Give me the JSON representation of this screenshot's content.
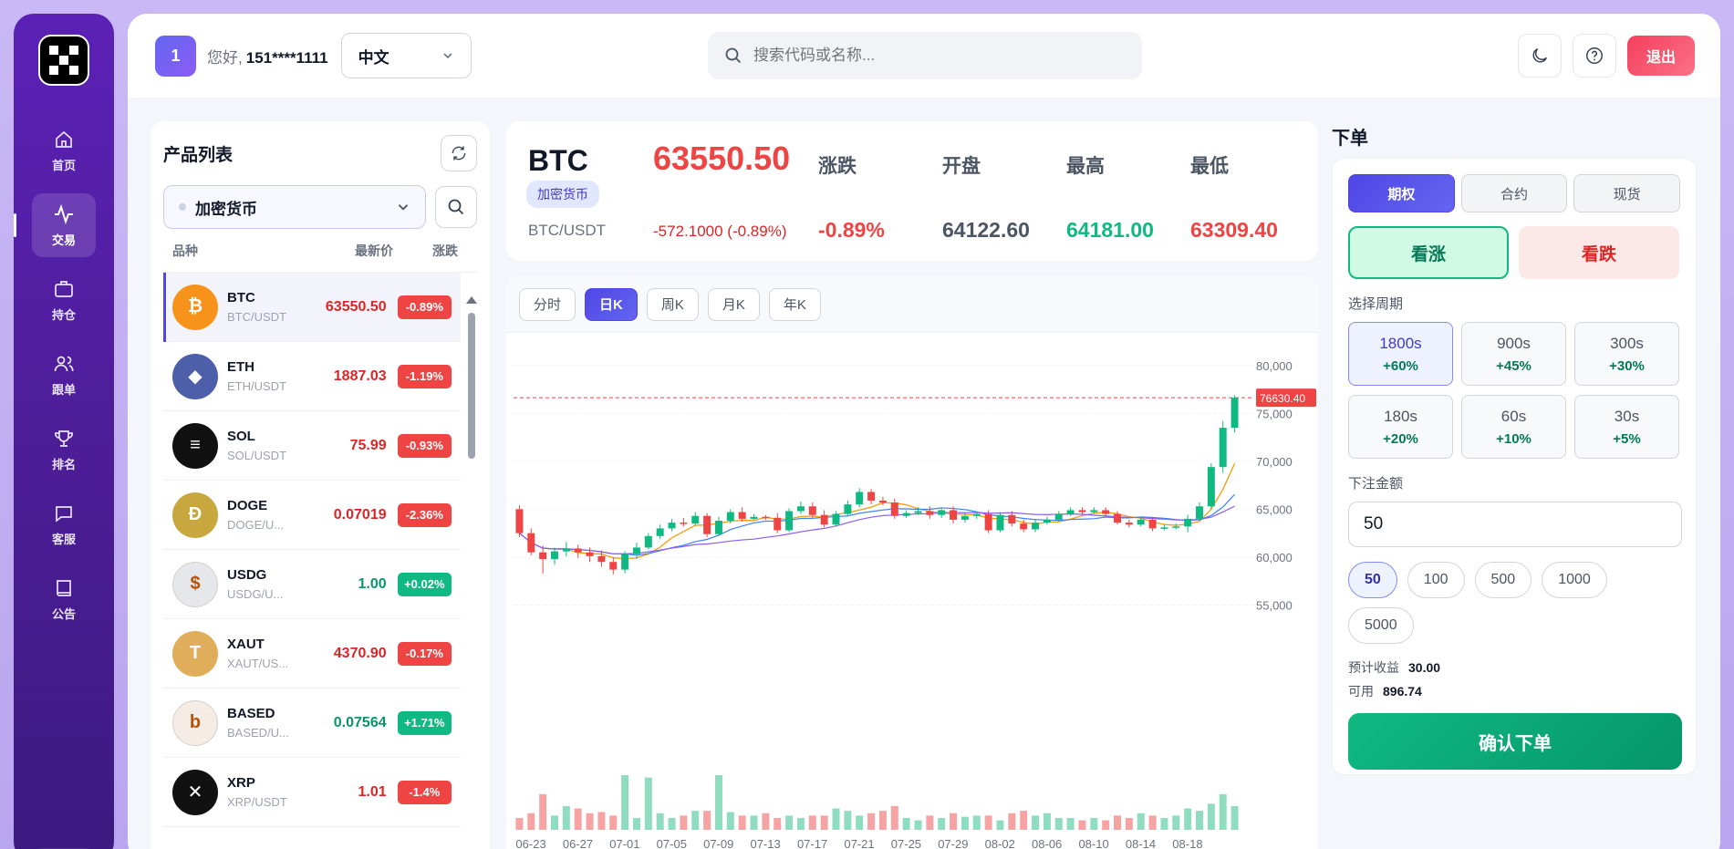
{
  "nav": {
    "items": [
      {
        "label": "首页",
        "icon": "home-icon"
      },
      {
        "label": "交易",
        "icon": "activity-icon",
        "active": true
      },
      {
        "label": "持仓",
        "icon": "briefcase-icon"
      },
      {
        "label": "跟单",
        "icon": "users-icon"
      },
      {
        "label": "排名",
        "icon": "trophy-icon"
      },
      {
        "label": "客服",
        "icon": "chat-icon"
      },
      {
        "label": "公告",
        "icon": "book-icon"
      }
    ]
  },
  "header": {
    "user_badge": "1",
    "greeting": "您好,",
    "username": "151****1111",
    "language": "中文",
    "search_placeholder": "搜索代码或名称...",
    "logout_label": "退出"
  },
  "products": {
    "title": "产品列表",
    "category": "加密货币",
    "columns": {
      "name": "品种",
      "price": "最新价",
      "change": "涨跌"
    },
    "items": [
      {
        "symbol": "BTC",
        "pair": "BTC/USDT",
        "price": "63550.50",
        "change": "-0.89%",
        "dir": "neg",
        "color": "#f7931a",
        "glyph": "₿"
      },
      {
        "symbol": "ETH",
        "pair": "ETH/USDT",
        "price": "1887.03",
        "change": "-1.19%",
        "dir": "neg",
        "color": "#4c5fa8",
        "glyph": "◆"
      },
      {
        "symbol": "SOL",
        "pair": "SOL/USDT",
        "price": "75.99",
        "change": "-0.93%",
        "dir": "neg",
        "color": "#111111",
        "glyph": "≡"
      },
      {
        "symbol": "DOGE",
        "pair": "DOGE/U...",
        "price": "0.07019",
        "change": "-2.36%",
        "dir": "neg",
        "color": "#c9a73f",
        "glyph": "Ð"
      },
      {
        "symbol": "USDG",
        "pair": "USDG/U...",
        "price": "1.00",
        "change": "+0.02%",
        "dir": "pos",
        "color": "#e5e7eb",
        "glyph": "$"
      },
      {
        "symbol": "XAUT",
        "pair": "XAUT/US...",
        "price": "4370.90",
        "change": "-0.17%",
        "dir": "neg",
        "color": "#e0ad5b",
        "glyph": "T"
      },
      {
        "symbol": "BASED",
        "pair": "BASED/U...",
        "price": "0.07564",
        "change": "+1.71%",
        "dir": "pos",
        "color": "#f5ece6",
        "glyph": "b"
      },
      {
        "symbol": "XRP",
        "pair": "XRP/USDT",
        "price": "1.01",
        "change": "-1.4%",
        "dir": "neg",
        "color": "#111111",
        "glyph": "✕"
      }
    ]
  },
  "quote": {
    "symbol": "BTC",
    "tag": "加密货币",
    "pair": "BTC/USDT",
    "price": "63550.50",
    "change_abs": "-572.1000 (-0.89%)",
    "labels": {
      "change": "涨跌",
      "open": "开盘",
      "high": "最高",
      "low": "最低"
    },
    "values": {
      "change": "-0.89%",
      "open": "64122.60",
      "high": "64181.00",
      "low": "63309.40"
    },
    "colors": {
      "down": "#ef4444",
      "up": "#10b981",
      "neutral": "#4b5563"
    }
  },
  "timeframes": [
    {
      "label": "分时"
    },
    {
      "label": "日K",
      "active": true
    },
    {
      "label": "周K"
    },
    {
      "label": "月K"
    },
    {
      "label": "年K"
    }
  ],
  "chart_data": {
    "type": "candlestick",
    "y_ticks": [
      "80,000",
      "75,000",
      "70,000",
      "65,000",
      "60,000",
      "55,000"
    ],
    "y_tick_values": [
      80000,
      75000,
      70000,
      65000,
      60000,
      55000
    ],
    "x_tick_labels": [
      "06-23",
      "06-27",
      "07-01",
      "07-05",
      "07-09",
      "07-13",
      "07-17",
      "07-21",
      "07-25",
      "07-29",
      "08-02",
      "08-06",
      "08-10",
      "08-14",
      "08-18"
    ],
    "last_price_marker": "76630.40",
    "last_price_value": 76630.4,
    "ylim": [
      52000,
      81500
    ],
    "candles": [
      [
        65000,
        62500,
        65400,
        62100
      ],
      [
        62500,
        60500,
        63000,
        60200
      ],
      [
        60500,
        59800,
        61200,
        58300
      ],
      [
        59800,
        60600,
        61000,
        59200
      ],
      [
        60600,
        60900,
        61600,
        60100
      ],
      [
        60900,
        60500,
        61300,
        59900
      ],
      [
        60500,
        60100,
        61000,
        59500
      ],
      [
        60100,
        59500,
        60700,
        59000
      ],
      [
        59500,
        58700,
        60000,
        58200
      ],
      [
        58700,
        60300,
        60600,
        58300
      ],
      [
        60300,
        61000,
        61500,
        59800
      ],
      [
        61000,
        62200,
        62500,
        60800
      ],
      [
        62200,
        63000,
        63400,
        61900
      ],
      [
        63000,
        63600,
        64000,
        62700
      ],
      [
        63600,
        63500,
        64100,
        63200
      ],
      [
        63500,
        64300,
        64700,
        63300
      ],
      [
        64300,
        62400,
        64600,
        62100
      ],
      [
        62400,
        63800,
        64200,
        62200
      ],
      [
        63800,
        64700,
        65000,
        63500
      ],
      [
        64700,
        64000,
        65200,
        63700
      ],
      [
        64000,
        64200,
        64500,
        63900
      ],
      [
        64200,
        64100,
        64400,
        63900
      ],
      [
        64100,
        62800,
        64600,
        62500
      ],
      [
        62800,
        64800,
        65100,
        62600
      ],
      [
        64800,
        65300,
        65800,
        64500
      ],
      [
        65300,
        64400,
        65700,
        64100
      ],
      [
        64400,
        63400,
        64900,
        63100
      ],
      [
        63400,
        64500,
        64800,
        63200
      ],
      [
        64500,
        65500,
        65900,
        64300
      ],
      [
        65500,
        66800,
        67200,
        65200
      ],
      [
        66800,
        65900,
        67100,
        65500
      ],
      [
        65900,
        65700,
        66300,
        65400
      ],
      [
        65700,
        64300,
        66100,
        64000
      ],
      [
        64300,
        64600,
        64900,
        64100
      ],
      [
        64600,
        64800,
        65200,
        64400
      ],
      [
        64800,
        64400,
        65300,
        64000
      ],
      [
        64400,
        64900,
        65200,
        64100
      ],
      [
        64900,
        63900,
        65300,
        63500
      ],
      [
        63900,
        64300,
        64700,
        63600
      ],
      [
        64300,
        64500,
        64800,
        64000
      ],
      [
        64500,
        62800,
        64900,
        62500
      ],
      [
        62800,
        64400,
        64700,
        62600
      ],
      [
        64400,
        63500,
        64800,
        63200
      ],
      [
        63500,
        62900,
        63900,
        62600
      ],
      [
        62900,
        63600,
        63900,
        62600
      ],
      [
        63600,
        63900,
        64200,
        63400
      ],
      [
        63900,
        64500,
        64800,
        63700
      ],
      [
        64500,
        64900,
        65200,
        64300
      ],
      [
        64900,
        64700,
        65200,
        64400
      ],
      [
        64700,
        64900,
        65200,
        64500
      ],
      [
        64900,
        64500,
        65200,
        64200
      ],
      [
        64500,
        63600,
        64800,
        63400
      ],
      [
        63600,
        63400,
        63900,
        63100
      ],
      [
        63400,
        63900,
        64200,
        63200
      ],
      [
        63900,
        63000,
        64200,
        62700
      ],
      [
        63000,
        63100,
        63400,
        62800
      ],
      [
        63100,
        63200,
        63500,
        62900
      ],
      [
        63200,
        64000,
        64400,
        62600
      ],
      [
        64000,
        65300,
        65700,
        63800
      ],
      [
        65300,
        69400,
        69800,
        65000
      ],
      [
        69400,
        73500,
        74200,
        68800
      ],
      [
        73500,
        76630,
        76900,
        73000
      ]
    ],
    "volumes": [
      10,
      14,
      30,
      12,
      20,
      18,
      14,
      15,
      12,
      46,
      10,
      44,
      14,
      10,
      12,
      16,
      16,
      46,
      15,
      12,
      12,
      14,
      10,
      12,
      10,
      12,
      12,
      18,
      16,
      12,
      14,
      16,
      20,
      10,
      8,
      12,
      10,
      14,
      11,
      12,
      12,
      8,
      14,
      16,
      12,
      14,
      10,
      10,
      8,
      10,
      8,
      12,
      10,
      14,
      12,
      10,
      12,
      18,
      16,
      22,
      30,
      20
    ]
  },
  "order": {
    "title": "下单",
    "tabs": [
      {
        "label": "期权",
        "active": true
      },
      {
        "label": "合约"
      },
      {
        "label": "现货"
      }
    ],
    "up_label": "看涨",
    "down_label": "看跌",
    "period_label": "选择周期",
    "periods": [
      {
        "sec": "1800s",
        "pct": "+60%",
        "active": true
      },
      {
        "sec": "900s",
        "pct": "+45%"
      },
      {
        "sec": "300s",
        "pct": "+30%"
      },
      {
        "sec": "180s",
        "pct": "+20%"
      },
      {
        "sec": "60s",
        "pct": "+10%"
      },
      {
        "sec": "30s",
        "pct": "+5%"
      }
    ],
    "amount_label": "下注金额",
    "amount_value": "50",
    "chips": [
      {
        "label": "50",
        "active": true
      },
      {
        "label": "100"
      },
      {
        "label": "500"
      },
      {
        "label": "1000"
      },
      {
        "label": "5000"
      }
    ],
    "expected_label": "预计收益",
    "expected_value": "30.00",
    "available_label": "可用",
    "available_value": "896.74",
    "confirm_label": "确认下单"
  }
}
